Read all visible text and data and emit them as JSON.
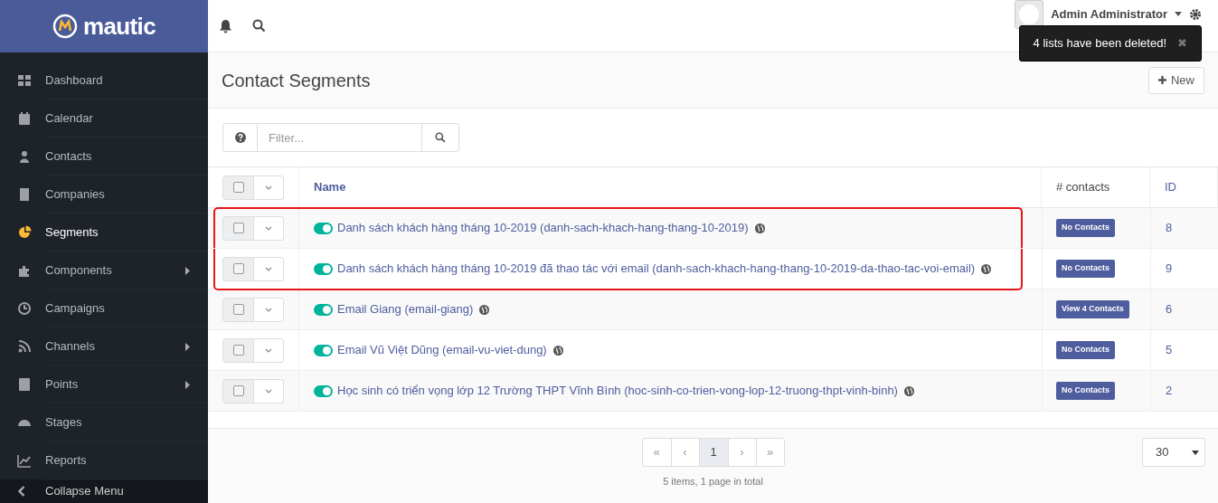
{
  "brand": "mautic",
  "sidebar": {
    "items": [
      {
        "label": "Dashboard",
        "selected": false,
        "submenu": false
      },
      {
        "label": "Calendar",
        "selected": false,
        "submenu": false
      },
      {
        "label": "Contacts",
        "selected": false,
        "submenu": false
      },
      {
        "label": "Companies",
        "selected": false,
        "submenu": false
      },
      {
        "label": "Segments",
        "selected": true,
        "submenu": false
      },
      {
        "label": "Components",
        "selected": false,
        "submenu": true
      },
      {
        "label": "Campaigns",
        "selected": false,
        "submenu": false
      },
      {
        "label": "Channels",
        "selected": false,
        "submenu": true
      },
      {
        "label": "Points",
        "selected": false,
        "submenu": true
      },
      {
        "label": "Stages",
        "selected": false,
        "submenu": false
      },
      {
        "label": "Reports",
        "selected": false,
        "submenu": false
      }
    ],
    "collapse": "Collapse Menu"
  },
  "user": {
    "name": "Admin Administrator"
  },
  "toast": {
    "message": "4 lists have been deleted!",
    "close": "✖"
  },
  "page": {
    "title": "Contact Segments",
    "new_button": "New",
    "filter_placeholder": "Filter..."
  },
  "table": {
    "select_all": {
      "checked": false
    },
    "columns": [
      "Name",
      "# contacts",
      "ID"
    ],
    "rows": [
      {
        "name": "Danh sách khách hàng tháng 10-2019 (danh-sach-khach-hang-thang-10-2019)",
        "published": true,
        "contacts": "No Contacts",
        "id": "8",
        "highlighted": true,
        "checked": false
      },
      {
        "name": "Danh sách khách hàng tháng 10-2019 đã thao tác với email (danh-sach-khach-hang-thang-10-2019-da-thao-tac-voi-email)",
        "published": true,
        "contacts": "No Contacts",
        "id": "9",
        "highlighted": true,
        "checked": false
      },
      {
        "name": "Email Giang (email-giang)",
        "published": true,
        "contacts": "View 4 Contacts",
        "id": "6",
        "highlighted": false,
        "checked": false
      },
      {
        "name": "Email Vũ Việt Dũng (email-vu-viet-dung)",
        "published": true,
        "contacts": "No Contacts",
        "id": "5",
        "highlighted": false,
        "checked": false
      },
      {
        "name": "Học sinh có triển vọng lớp 12 Trường THPT Vĩnh Bình (hoc-sinh-co-trien-vong-lop-12-truong-thpt-vinh-binh)",
        "published": true,
        "contacts": "No Contacts",
        "id": "2",
        "highlighted": false,
        "checked": false
      }
    ]
  },
  "pagination": {
    "pages": [
      {
        "label": "«",
        "selected": false
      },
      {
        "label": "‹",
        "selected": false
      },
      {
        "label": "1",
        "selected": true
      },
      {
        "label": "›",
        "selected": false
      },
      {
        "label": "»",
        "selected": false
      }
    ],
    "summary": "5 items, 1 page in total",
    "per_page": "30"
  }
}
